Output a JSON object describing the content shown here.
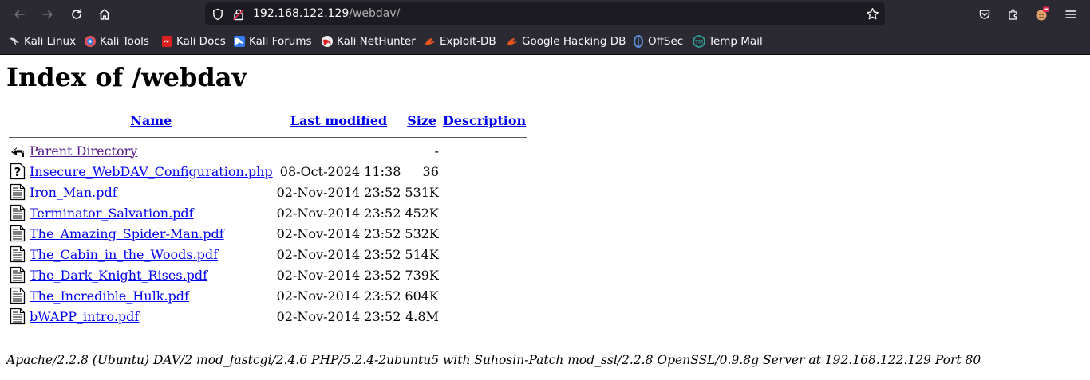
{
  "browser": {
    "url_host": "192.168.122.129",
    "url_path": "/webdav/",
    "bookmarks": [
      {
        "label": "Kali Linux",
        "icon": "kali-dragon-icon",
        "color": "#367bf0"
      },
      {
        "label": "Kali Tools",
        "icon": "kali-tools-icon",
        "color": "#e44d5a"
      },
      {
        "label": "Kali Docs",
        "icon": "kali-docs-icon",
        "color": "#d92121"
      },
      {
        "label": "Kali Forums",
        "icon": "kali-forums-icon",
        "color": "#367bf0"
      },
      {
        "label": "Kali NetHunter",
        "icon": "nethunter-icon",
        "color": "#d92121"
      },
      {
        "label": "Exploit-DB",
        "icon": "exploit-db-icon",
        "color": "#e95420"
      },
      {
        "label": "Google Hacking DB",
        "icon": "ghdb-icon",
        "color": "#e95420"
      },
      {
        "label": "OffSec",
        "icon": "offsec-icon",
        "color": "#5a8bd6"
      },
      {
        "label": "Temp Mail",
        "icon": "temp-mail-icon",
        "color": "#30a9a0"
      }
    ]
  },
  "page": {
    "title": "Index of /webdav",
    "columns": {
      "name": "Name",
      "modified": "Last modified",
      "size": "Size",
      "description": "Description"
    },
    "parent": {
      "name": "Parent Directory",
      "size": "-",
      "icon": "back-arrow-icon"
    },
    "entries": [
      {
        "name": "Insecure_WebDAV_Configuration.php",
        "modified": "08-Oct-2024 11:38",
        "size": "36",
        "icon": "unknown-file-icon"
      },
      {
        "name": "Iron_Man.pdf",
        "modified": "02-Nov-2014 23:52",
        "size": "531K",
        "icon": "text-file-icon"
      },
      {
        "name": "Terminator_Salvation.pdf",
        "modified": "02-Nov-2014 23:52",
        "size": "452K",
        "icon": "text-file-icon"
      },
      {
        "name": "The_Amazing_Spider-Man.pdf",
        "modified": "02-Nov-2014 23:52",
        "size": "532K",
        "icon": "text-file-icon"
      },
      {
        "name": "The_Cabin_in_the_Woods.pdf",
        "modified": "02-Nov-2014 23:52",
        "size": "514K",
        "icon": "text-file-icon"
      },
      {
        "name": "The_Dark_Knight_Rises.pdf",
        "modified": "02-Nov-2014 23:52",
        "size": "739K",
        "icon": "text-file-icon"
      },
      {
        "name": "The_Incredible_Hulk.pdf",
        "modified": "02-Nov-2014 23:52",
        "size": "604K",
        "icon": "text-file-icon"
      },
      {
        "name": "bWAPP_intro.pdf",
        "modified": "02-Nov-2014 23:52",
        "size": "4.8M",
        "icon": "text-file-icon"
      }
    ],
    "footer": "Apache/2.2.8 (Ubuntu) DAV/2 mod_fastcgi/2.4.6 PHP/5.2.4-2ubuntu5 with Suhosin-Patch mod_ssl/2.2.8 OpenSSL/0.9.8g Server at 192.168.122.129 Port 80"
  }
}
